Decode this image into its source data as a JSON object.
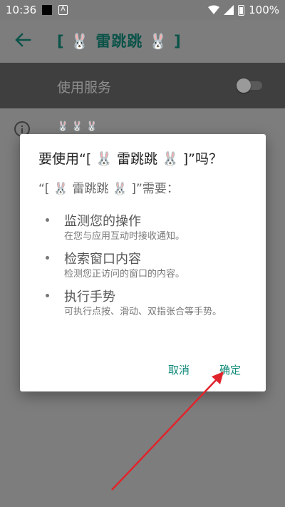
{
  "status_bar": {
    "time": "10:36",
    "battery": "100%"
  },
  "app_bar": {
    "title": "[ 🐰 雷跳跳 🐰 ]"
  },
  "service": {
    "label": "使用服务",
    "enabled": false
  },
  "background_list": {
    "item_text": "🐰 🐰 🐰"
  },
  "dialog": {
    "title": "要使用“[ 🐰 雷跳跳 🐰 ]”吗？",
    "subtitle": "“[ 🐰 雷跳跳 🐰 ]”需要：",
    "permissions": [
      {
        "title": "监测您的操作",
        "desc": "在您与应用互动时接收通知。"
      },
      {
        "title": "检索窗口内容",
        "desc": "检测您正访问的窗口的内容。"
      },
      {
        "title": "执行手势",
        "desc": "可执行点按、滑动、双指张合等手势。"
      }
    ],
    "cancel_label": "取消",
    "ok_label": "确定"
  },
  "colors": {
    "accent": "#0e8a79",
    "arrow": "#e0242b"
  }
}
